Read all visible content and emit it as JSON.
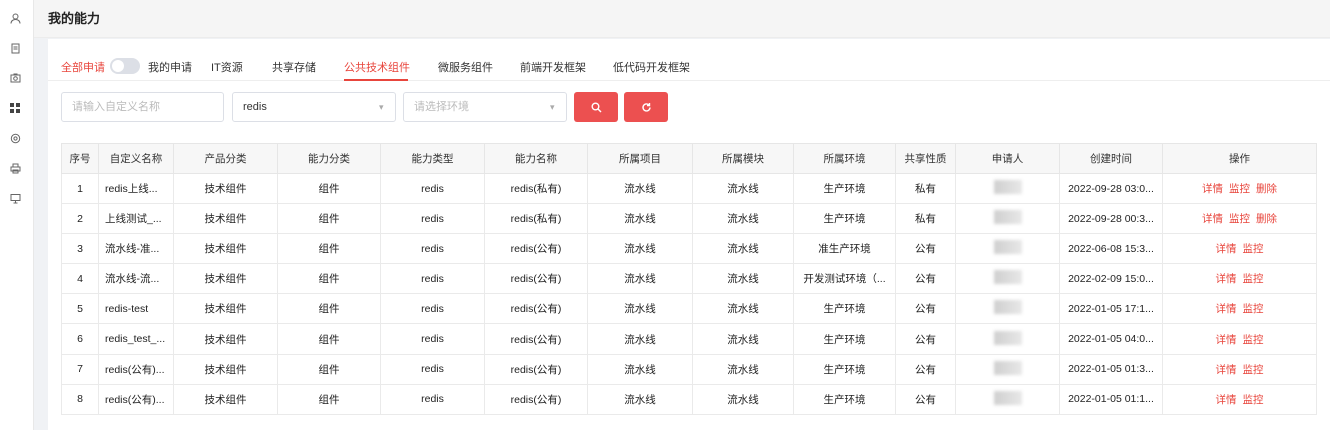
{
  "sidebar": {
    "icons": [
      "user-icon",
      "document-icon",
      "camera-icon",
      "grid-icon",
      "headset-icon",
      "printer-icon",
      "monitor-icon"
    ]
  },
  "header": {
    "title": "我的能力"
  },
  "tabs": {
    "all_apply": "全部申请",
    "my_apply": "我的申请",
    "items": [
      "IT资源",
      "共享存储",
      "公共技术组件",
      "微服务组件",
      "前端开发框架",
      "低代码开发框架"
    ]
  },
  "filters": {
    "name_placeholder": "请输入自定义名称",
    "ability_value": "redis",
    "env_placeholder": "请选择环境"
  },
  "table": {
    "headers": [
      "序号",
      "自定义名称",
      "产品分类",
      "能力分类",
      "能力类型",
      "能力名称",
      "所属项目",
      "所属模块",
      "所属环境",
      "共享性质",
      "申请人",
      "创建时间",
      "操作"
    ],
    "rows": [
      {
        "no": "1",
        "name": "redis上线...",
        "product": "技术组件",
        "category": "组件",
        "type": "redis",
        "ability": "redis(私有)",
        "project": "流水线",
        "module": "流水线",
        "env": "生产环境",
        "share": "私有",
        "time": "2022-09-28 03:0...",
        "ops": [
          "详情",
          "监控",
          "删除"
        ]
      },
      {
        "no": "2",
        "name": "上线测试_...",
        "product": "技术组件",
        "category": "组件",
        "type": "redis",
        "ability": "redis(私有)",
        "project": "流水线",
        "module": "流水线",
        "env": "生产环境",
        "share": "私有",
        "time": "2022-09-28 00:3...",
        "ops": [
          "详情",
          "监控",
          "删除"
        ]
      },
      {
        "no": "3",
        "name": "流水线-准...",
        "product": "技术组件",
        "category": "组件",
        "type": "redis",
        "ability": "redis(公有)",
        "project": "流水线",
        "module": "流水线",
        "env": "准生产环境",
        "share": "公有",
        "time": "2022-06-08 15:3...",
        "ops": [
          "详情",
          "监控"
        ]
      },
      {
        "no": "4",
        "name": "流水线-流...",
        "product": "技术组件",
        "category": "组件",
        "type": "redis",
        "ability": "redis(公有)",
        "project": "流水线",
        "module": "流水线",
        "env": "开发测试环境（...",
        "share": "公有",
        "time": "2022-02-09 15:0...",
        "ops": [
          "详情",
          "监控"
        ]
      },
      {
        "no": "5",
        "name": "redis-test",
        "product": "技术组件",
        "category": "组件",
        "type": "redis",
        "ability": "redis(公有)",
        "project": "流水线",
        "module": "流水线",
        "env": "生产环境",
        "share": "公有",
        "time": "2022-01-05 17:1...",
        "ops": [
          "详情",
          "监控"
        ]
      },
      {
        "no": "6",
        "name": "redis_test_...",
        "product": "技术组件",
        "category": "组件",
        "type": "redis",
        "ability": "redis(公有)",
        "project": "流水线",
        "module": "流水线",
        "env": "生产环境",
        "share": "公有",
        "time": "2022-01-05 04:0...",
        "ops": [
          "详情",
          "监控"
        ]
      },
      {
        "no": "7",
        "name": "redis(公有)...",
        "product": "技术组件",
        "category": "组件",
        "type": "redis",
        "ability": "redis(公有)",
        "project": "流水线",
        "module": "流水线",
        "env": "生产环境",
        "share": "公有",
        "time": "2022-01-05 01:3...",
        "ops": [
          "详情",
          "监控"
        ]
      },
      {
        "no": "8",
        "name": "redis(公有)...",
        "product": "技术组件",
        "category": "组件",
        "type": "redis",
        "ability": "redis(公有)",
        "project": "流水线",
        "module": "流水线",
        "env": "生产环境",
        "share": "公有",
        "time": "2022-01-05 01:1...",
        "ops": [
          "详情",
          "监控"
        ]
      }
    ]
  },
  "colors": {
    "accent": "#e8453c",
    "button": "#ec5050"
  }
}
